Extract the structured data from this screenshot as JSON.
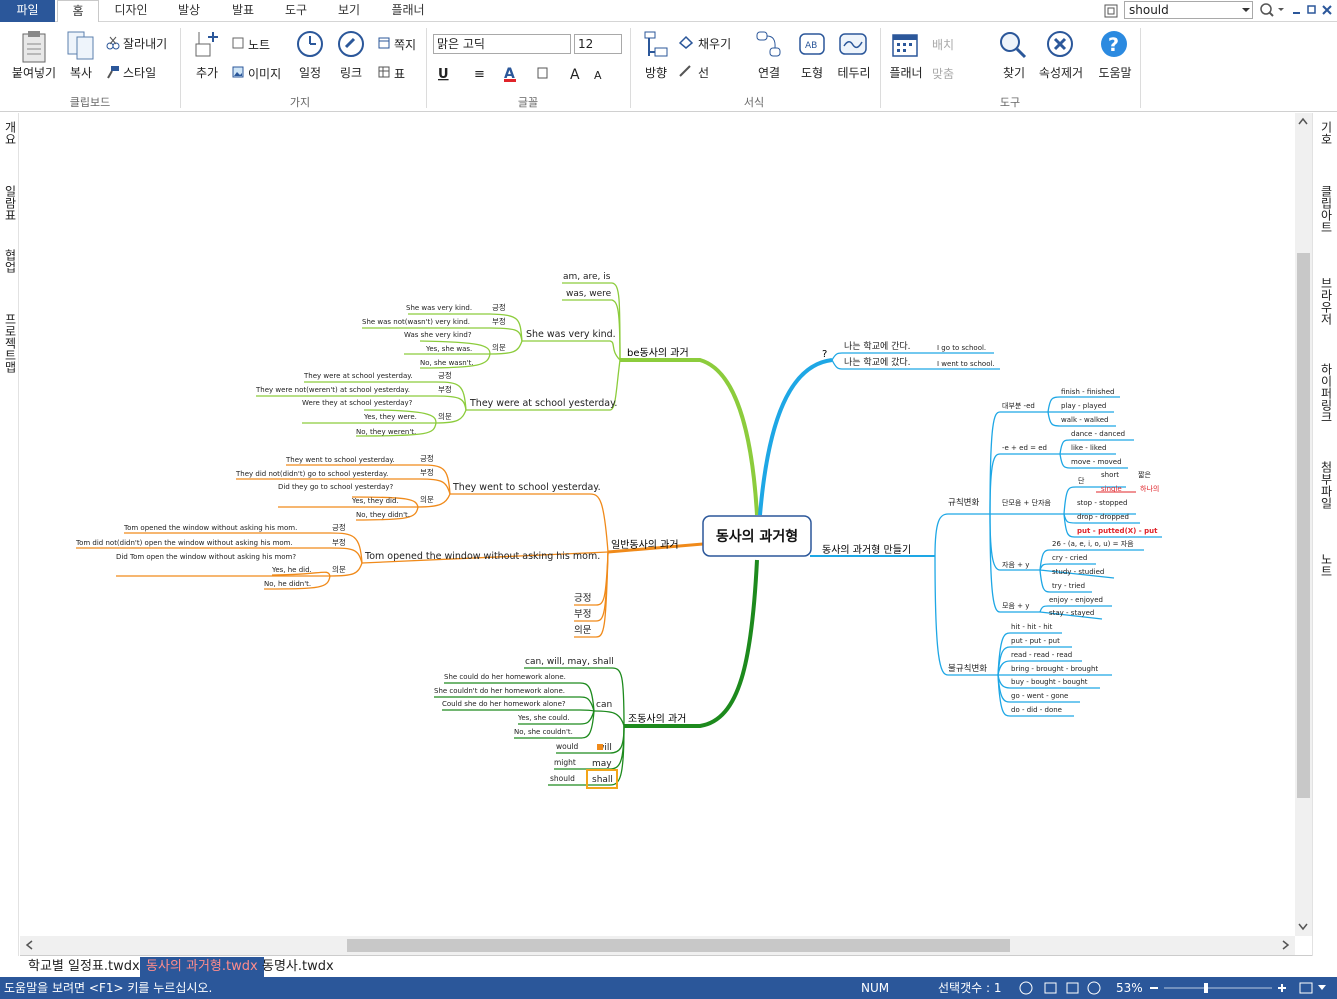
{
  "menu_tabs": [
    "파일",
    "홈",
    "디자인",
    "발상",
    "발표",
    "도구",
    "보기",
    "플래너"
  ],
  "search": {
    "value": "should"
  },
  "ribbon": {
    "clipboard": {
      "paste": "붙여넣기",
      "copy": "복사",
      "cut": "잘라내기",
      "style": "스타일",
      "group": "클립보드"
    },
    "branch": {
      "add": "추가",
      "note": "노트",
      "image": "이미지",
      "schedule": "일정",
      "link": "링크",
      "memo": "쪽지",
      "table": "표",
      "group": "가지"
    },
    "font": {
      "name": "맑은 고딕",
      "size": "12",
      "group": "글꼴"
    },
    "format": {
      "direction": "방향",
      "fill": "채우기",
      "line": "선",
      "connect": "연결",
      "shape": "도형",
      "border": "테두리",
      "group": "서식"
    },
    "tools": {
      "planner": "플래너",
      "arrange": "배치",
      "fit": "맞춤",
      "find": "찾기",
      "clear": "속성제거",
      "help": "도움말",
      "group": "도구"
    }
  },
  "left_panel": [
    "개요",
    "일람표",
    "협업",
    "프로젝트맵"
  ],
  "right_panel": [
    "기호",
    "클립아트",
    "브라우저",
    "하이퍼링크",
    "첨부파일",
    "노트"
  ],
  "doc_tabs": [
    "학교별 일정표.twdx",
    "동사의 과거형.twdx",
    "동명사.twdx"
  ],
  "status": {
    "help": "도움말을 보려면 <F1> 키를 누르십시오.",
    "num": "NUM",
    "selection": "선택갯수 : 1",
    "zoom": "53%"
  },
  "mindmap": {
    "central": "동사의 과거형",
    "b1": "be동사의 과거",
    "b1_a": "am, are, is",
    "b1_b": "was, were",
    "b1_c": "She was very kind.",
    "b1_c1": "She was very kind.",
    "b1_c2": "She was not(wasn't) very kind.",
    "b1_c3": "Was she very kind?",
    "b1_c4": "Yes, she was.",
    "b1_c5": "No, she wasn't.",
    "b1_d": "They were at school yesterday.",
    "b1_d1": "They were at school yesterday.",
    "b1_d2": "They were not(weren't) at school yesterday.",
    "b1_d3": "Were they at school yesterday?",
    "b1_d4": "Yes, they were.",
    "b1_d5": "No, they weren't.",
    "pos": "긍정",
    "neg": "부정",
    "q": "의문",
    "b2": "일반동사의 과거",
    "b2_a": "They went to school yesterday.",
    "b2_a1": "They went to school yesterday.",
    "b2_a2": "They did not(didn't) go to school yesterday.",
    "b2_a3": "Did they go to school yesterday?",
    "b2_a4": "Yes, they did.",
    "b2_a5": "No, they didn't.",
    "b2_b": "Tom opened the window without asking his mom.",
    "b2_b1": "Tom opened the window without asking his mom.",
    "b2_b2": "Tom did not(didn't) open the window without asking his mom.",
    "b2_b3": "Did Tom open the window without asking his mom?",
    "b2_b4": "Yes, he did.",
    "b2_b5": "No, he didn't.",
    "b3": "조동사의 과거",
    "b3_a": "can, will, may, shall",
    "b3_can": "can",
    "b3_c1": "She could do her homework alone.",
    "b3_c2": "She couldn't do her homework alone.",
    "b3_c3": "Could she do her homework alone?",
    "b3_c4": "Yes, she could.",
    "b3_c5": "No, she couldn't.",
    "b3_will": "will",
    "b3_would": "would",
    "b3_may": "may",
    "b3_might": "might",
    "b3_shall": "shall",
    "b3_should": "should",
    "b4": "?",
    "b4_a": "나는 학교에 간다.",
    "b4_a1": "I go to school.",
    "b4_b": "나는 학교에 갔다.",
    "b4_b1": "I went to school.",
    "b5": "동사의 과거형 만들기",
    "reg": "규칙변화",
    "r1": "대부분 -ed",
    "r1_1": "finish - finished",
    "r1_2": "play - played",
    "r1_3": "walk - walked",
    "r2": "-e + ed = ed",
    "r2_1": "dance - danced",
    "r2_2": "like - liked",
    "r2_3": "move - moved",
    "r3": "단모음 + 단자음",
    "r3_dan": "단",
    "r3_short": "short",
    "r3_single": "single",
    "r3_jjalbeun": "짧은",
    "r3_hana": "하나의",
    "r3_1": "stop - stopped",
    "r3_2": "drop - dropped",
    "r3_3": "put - putted(X) - put",
    "r4": "자음 + y",
    "r4_note": "26 - (a, e, i, o, u) = 자음",
    "r4_1": "cry - cried",
    "r4_2": "study - studied",
    "r4_3": "try - tried",
    "r5": "모음 + y",
    "r5_1": "enjoy - enjoyed",
    "r5_2": "stay - stayed",
    "irr": "불규칙변화",
    "i1": "hit - hit - hit",
    "i2": "put - put - put",
    "i3": "read - read - read",
    "i4": "bring - brought - brought",
    "i5": "buy - bought - bought",
    "i6": "go - went - gone",
    "i7": "do - did - done"
  },
  "colors": {
    "ribbon_blue": "#2b579a",
    "green": "#8ccc3c",
    "orange": "#f08a1a",
    "darkgreen": "#1d8a1d",
    "blue": "#1ea7e5",
    "red": "#e0242a"
  }
}
